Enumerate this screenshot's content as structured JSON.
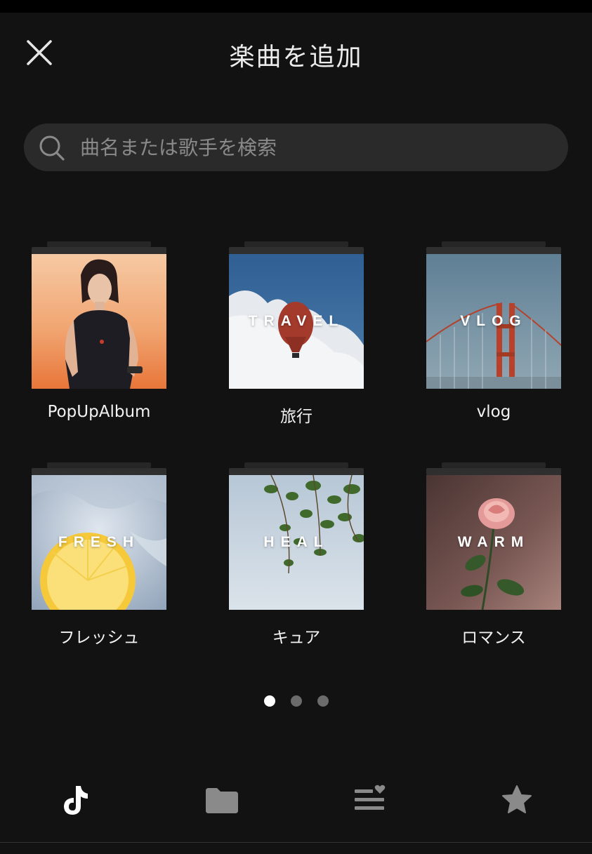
{
  "header": {
    "title": "楽曲を追加",
    "close_icon": "close-icon"
  },
  "search": {
    "placeholder": "曲名または歌手を検索",
    "icon": "search-icon"
  },
  "playlists": [
    {
      "label": "PopUpAlbum",
      "cover_text": ""
    },
    {
      "label": "旅行",
      "cover_text": "TRAVEL"
    },
    {
      "label": "vlog",
      "cover_text": "VLOG"
    },
    {
      "label": "フレッシュ",
      "cover_text": "FRESH"
    },
    {
      "label": "キュア",
      "cover_text": "HEAL"
    },
    {
      "label": "ロマンス",
      "cover_text": "WARM"
    }
  ],
  "pagination": {
    "pages": 3,
    "current": 1
  },
  "tabs": [
    {
      "name": "tiktok-icon",
      "active": true
    },
    {
      "name": "folder-icon",
      "active": false
    },
    {
      "name": "playlist-heart-icon",
      "active": false
    },
    {
      "name": "star-icon",
      "active": false
    }
  ],
  "colors": {
    "background": "#121212",
    "search_background": "#2a2a2a",
    "active_icon": "#ffffff",
    "inactive_icon": "#8a8a8a"
  }
}
